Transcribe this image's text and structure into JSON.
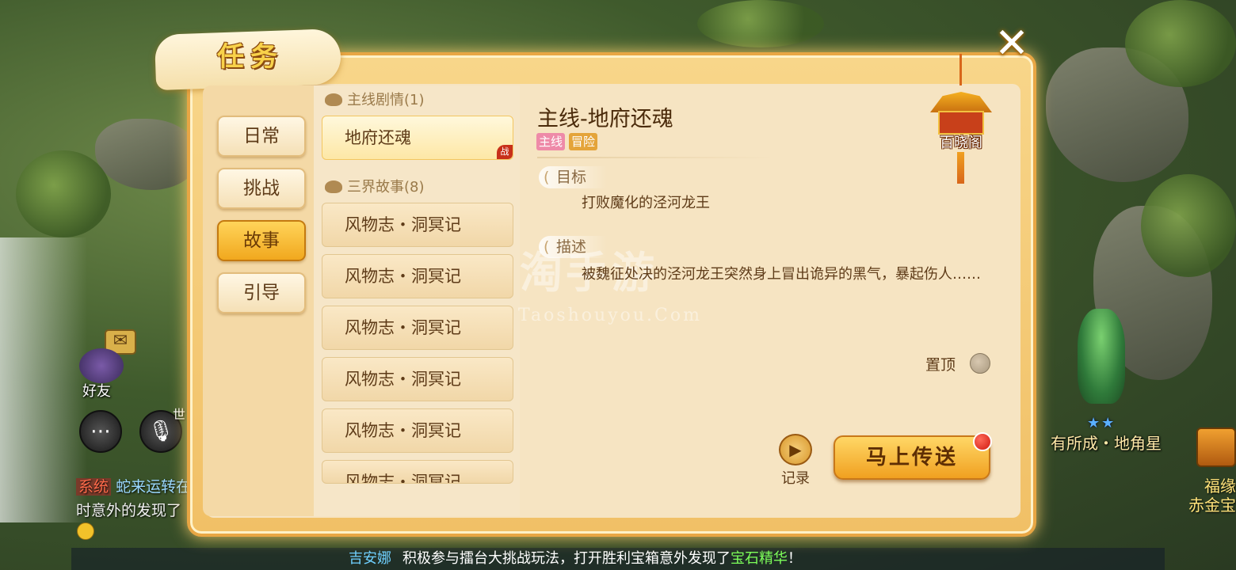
{
  "panel": {
    "title": "任务",
    "close_symbol": "✕"
  },
  "tabs": [
    {
      "label": "日常",
      "active": false
    },
    {
      "label": "挑战",
      "active": false
    },
    {
      "label": "故事",
      "active": true
    },
    {
      "label": "引导",
      "active": false
    }
  ],
  "quest_list": {
    "group_main": "主线剧情(1)",
    "group_story": "三界故事(8)",
    "main_items": [
      {
        "label": "地府还魂",
        "selected": true,
        "badge": "战"
      }
    ],
    "story_items": [
      {
        "label": "风物志・洞冥记"
      },
      {
        "label": "风物志・洞冥记"
      },
      {
        "label": "风物志・洞冥记"
      },
      {
        "label": "风物志・洞冥记"
      },
      {
        "label": "风物志・洞冥记"
      },
      {
        "label": "风物志・洞冥记"
      }
    ]
  },
  "detail": {
    "title": "主线-地府还魂",
    "tags": [
      "主线",
      "冒险"
    ],
    "goal_heading": "目标",
    "goal_text": "打败魔化的泾河龙王",
    "desc_heading": "描述",
    "desc_text": "被魏征处决的泾河龙王突然身上冒出诡异的黑气，暴起伤人……",
    "pin_label": "置顶",
    "record_label": "记录",
    "teleport_label": "马上传送",
    "pavilion_label": "百晓阁"
  },
  "watermark": {
    "main": "淘手游",
    "sub": "Taoshouyou.Com"
  },
  "hud": {
    "friend_label": "好友",
    "world_label": "世",
    "chat_tag": "系统",
    "chat_line1": "蛇来运转在",
    "chat_line2": "时意外的发现了"
  },
  "ticker": {
    "name": "吉安娜",
    "text": "积极参与擂台大挑战玩法，打开胜利宝箱意外发现了",
    "highlight": "宝石精华",
    "end": "！"
  },
  "world": {
    "npc_stars": "★★",
    "npc_name": "有所成・地角星",
    "side_label1": "福缘",
    "side_label2": "赤金宝"
  },
  "icons": {
    "close": "close-icon",
    "mail": "mail-icon",
    "chat": "chat-icon",
    "mic": "microphone-icon",
    "record": "video-camera-icon",
    "pavilion": "pavilion-icon",
    "group": "scroll-icon"
  },
  "colors": {
    "accent": "#f0a020",
    "panel_border": "#e8a644",
    "text_dark": "#5e3b18",
    "tag_main": "#ee8aa8",
    "tag_adventure": "#e4a43a",
    "red_dot": "#d01a10"
  }
}
